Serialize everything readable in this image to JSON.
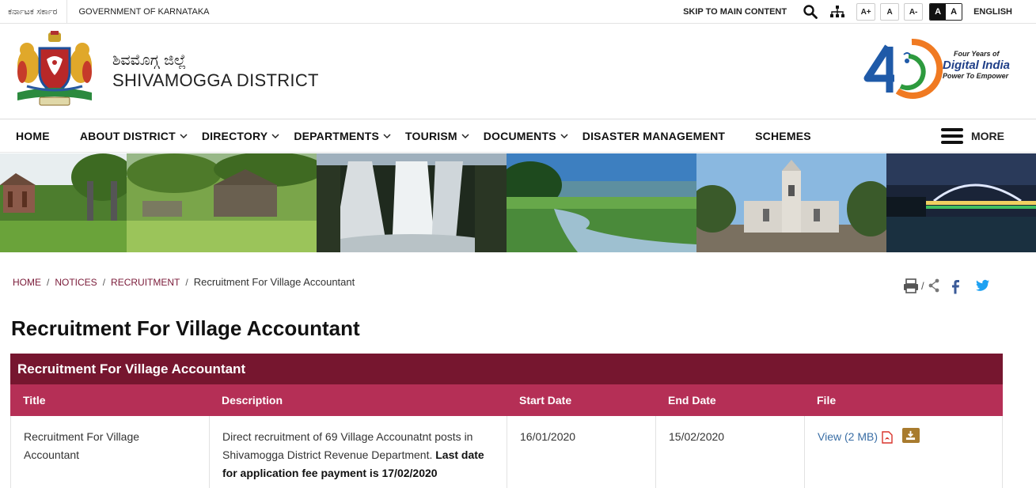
{
  "topbar": {
    "gov_kannada": "ಕರ್ನಾಟಕ ಸರ್ಕಾರ",
    "gov_english": "GOVERNMENT OF KARNATAKA",
    "skip": "SKIP TO MAIN CONTENT",
    "font_increase": "A+",
    "font_normal": "A",
    "font_decrease": "A-",
    "contrast_dark": "A",
    "contrast_light": "A",
    "language": "ENGLISH"
  },
  "header": {
    "title_kannada": "ಶಿವಮೊಗ್ಗ ಜಿಲ್ಲೆ",
    "title_english": "SHIVAMOGGA DISTRICT",
    "digital_india": {
      "line1": "Four Years of",
      "line2": "Digital India",
      "line3": "Power To Empower"
    }
  },
  "nav": {
    "items": [
      {
        "label": "HOME",
        "dropdown": false
      },
      {
        "label": "ABOUT DISTRICT",
        "dropdown": true
      },
      {
        "label": "DIRECTORY",
        "dropdown": true
      },
      {
        "label": "DEPARTMENTS",
        "dropdown": true
      },
      {
        "label": "TOURISM",
        "dropdown": true
      },
      {
        "label": "DOCUMENTS",
        "dropdown": true
      },
      {
        "label": "DISASTER MANAGEMENT",
        "dropdown": false
      },
      {
        "label": "SCHEMES",
        "dropdown": false
      }
    ],
    "more": "MORE"
  },
  "breadcrumb": {
    "home": "HOME",
    "notices": "NOTICES",
    "recruitment": "RECRUITMENT",
    "current": "Recruitment For Village Accountant",
    "sep": "/"
  },
  "tools": {
    "sep": "/"
  },
  "page": {
    "title": "Recruitment For Village Accountant"
  },
  "table": {
    "caption": "Recruitment For Village Accountant",
    "columns": [
      "Title",
      "Description",
      "Start Date",
      "End Date",
      "File"
    ],
    "rows": [
      {
        "title": "Recruitment For Village Accountant",
        "description": "Direct recruitment of 69 Village Accounatnt posts in Shivamogga District Revenue Department.",
        "description_bold": "Last date for application fee payment is 17/02/2020",
        "start_date": "16/01/2020",
        "end_date": "15/02/2020",
        "file_label": "View (2 MB)"
      }
    ]
  },
  "colors": {
    "caption_bg": "#76162f",
    "header_bg": "#b52f56",
    "breadcrumb_link": "#7a1a38",
    "file_link": "#3a6ea5",
    "download_btn": "#a87b2e"
  }
}
